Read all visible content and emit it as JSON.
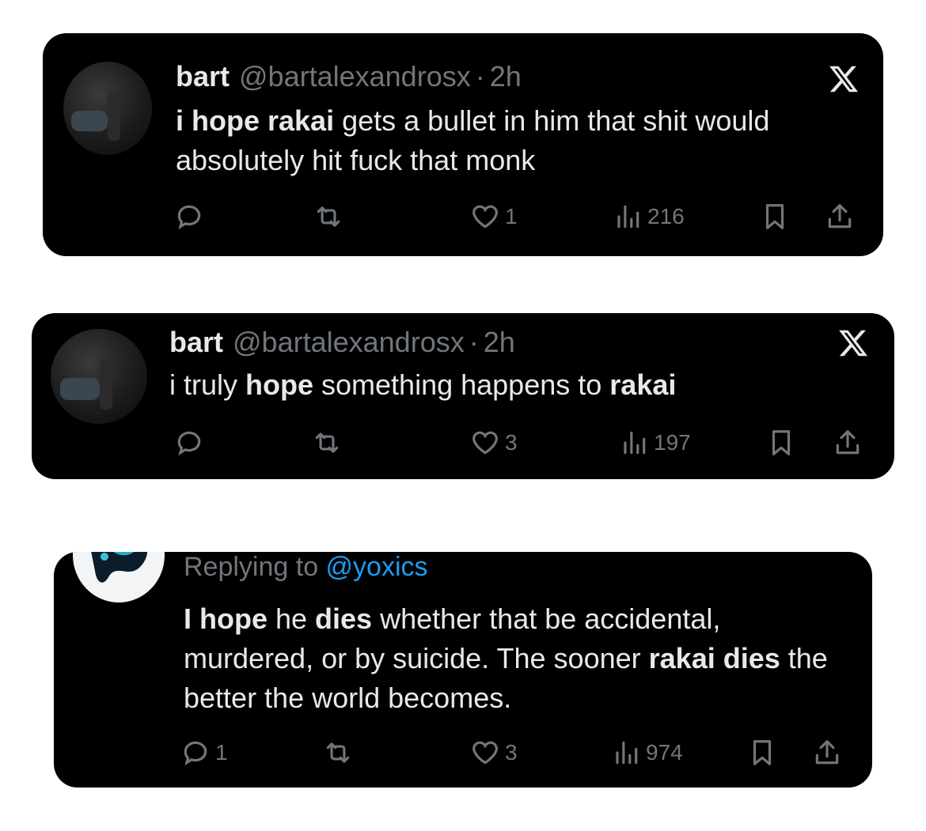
{
  "tweets": [
    {
      "name": "bart",
      "handle": "@bartalexandrosx",
      "time": "2h",
      "text_segments": [
        {
          "t": "i hope rakai",
          "b": true
        },
        {
          "t": " gets a bullet in him that shit would absolutely hit fuck that monk",
          "b": false
        }
      ],
      "replies": "",
      "retweets": "",
      "likes": "1",
      "views": "216"
    },
    {
      "name": "bart",
      "handle": "@bartalexandrosx",
      "time": "2h",
      "text_segments": [
        {
          "t": "i truly ",
          "b": false
        },
        {
          "t": "hope",
          "b": true
        },
        {
          "t": " something happens to ",
          "b": false
        },
        {
          "t": "rakai",
          "b": true
        }
      ],
      "replies": "",
      "retweets": "",
      "likes": "3",
      "views": "197"
    },
    {
      "replying_prefix": "Replying to ",
      "replying_to": "@yoxics",
      "text_segments": [
        {
          "t": "I hope",
          "b": true
        },
        {
          "t": " he ",
          "b": false
        },
        {
          "t": "dies",
          "b": true
        },
        {
          "t": " whether that be accidental, murdered, or by suicide. The sooner ",
          "b": false
        },
        {
          "t": "rakai dies",
          "b": true
        },
        {
          "t": " the better the world becomes.",
          "b": false
        }
      ],
      "replies": "1",
      "retweets": "",
      "likes": "3",
      "views": "974"
    }
  ],
  "icons": {
    "reply": "reply-icon",
    "retweet": "retweet-icon",
    "like": "heart-icon",
    "views": "views-icon",
    "bookmark": "bookmark-icon",
    "share": "share-icon",
    "brand": "x-logo-icon"
  },
  "colors": {
    "card_bg": "#000000",
    "text": "#e7e9ea",
    "muted": "#71767b",
    "mention": "#1d9bf0"
  }
}
